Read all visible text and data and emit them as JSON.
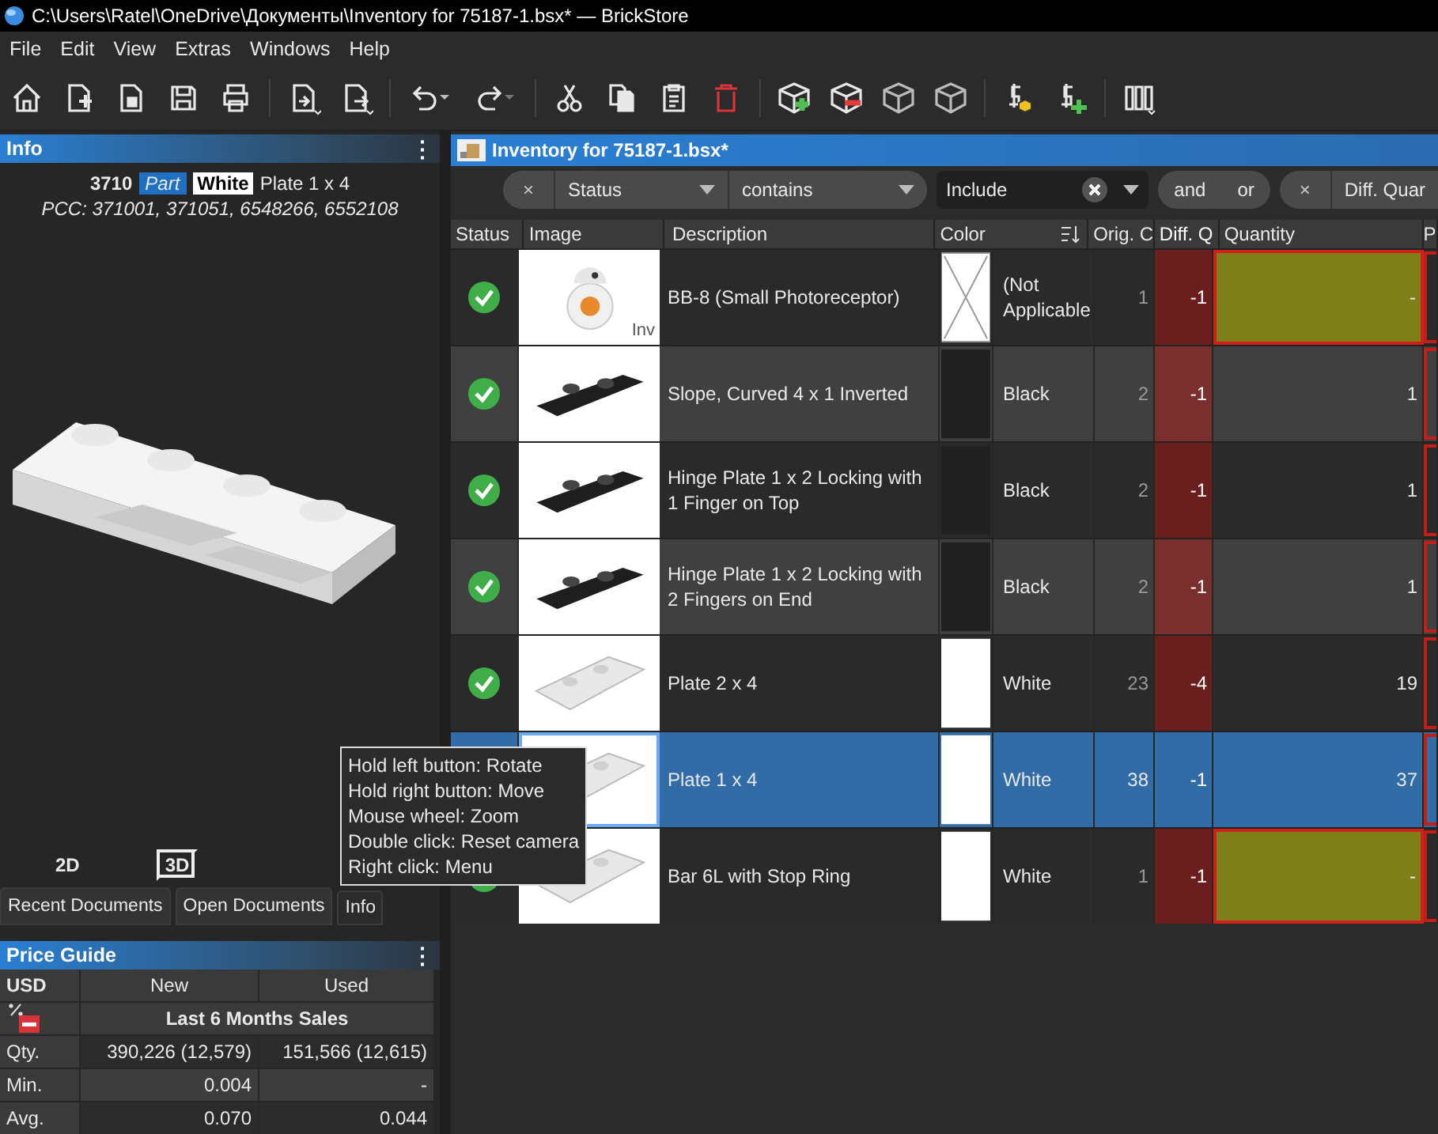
{
  "window": {
    "title": "C:\\Users\\Ratel\\OneDrive\\Документы\\Inventory for 75187-1.bsx* — BrickStore"
  },
  "menu": [
    "File",
    "Edit",
    "View",
    "Extras",
    "Windows",
    "Help"
  ],
  "info_panel": {
    "title": "Info",
    "menu_icon": "⋮",
    "item_id": "3710",
    "item_type": "Part",
    "color_name": "White",
    "item_name": "Plate 1 x 4",
    "pcc": "PCC: 371001, 371051, 6548266, 6552108",
    "view_modes": [
      {
        "label": "2D",
        "selected": false
      },
      {
        "label": "3D",
        "selected": true
      }
    ]
  },
  "tooltip": [
    "Hold left button: Rotate",
    "Hold right button: Move",
    "Mouse wheel: Zoom",
    "Double click: Reset camera",
    "Right click: Menu"
  ],
  "dock_tabs": [
    {
      "label": "Recent Documents",
      "selected": false
    },
    {
      "label": "Open Documents",
      "selected": false
    },
    {
      "label": "Info",
      "selected": true
    }
  ],
  "price_guide": {
    "title": "Price Guide",
    "menu_icon": "⋮",
    "currency": "USD",
    "columns": [
      "New",
      "Used"
    ],
    "period": "Last 6 Months Sales",
    "rows": [
      {
        "label": "Qty.",
        "new": "390,226 (12,579)",
        "used": "151,566 (12,615)"
      },
      {
        "label": "Min.",
        "new": "0.004",
        "used": "-"
      },
      {
        "label": "Avg.",
        "new": "0.070",
        "used": "0.044"
      }
    ]
  },
  "document": {
    "title": "Inventory for 75187-1.bsx*",
    "filters": [
      {
        "remove": "×",
        "field": "Status",
        "operator": "contains",
        "value": "Include"
      }
    ],
    "combinators": [
      "and",
      "or"
    ],
    "next_filter": {
      "remove": "×",
      "field": "Diff. Quar"
    },
    "columns": [
      "Status",
      "Image",
      "Description",
      "Color",
      "Orig. C",
      "Diff. Q",
      "Quantity",
      "P"
    ],
    "rows": [
      {
        "status_ok": true,
        "description": "BB-8 (Small Photoreceptor)",
        "image_badge": "Inv",
        "color": "#ffffff",
        "not_applicable": true,
        "color_name": "(Not Applicable",
        "orig": "1",
        "diff": "-1",
        "quantity": "-",
        "flagged": true,
        "selected": false
      },
      {
        "status_ok": true,
        "description": "Slope, Curved 4 x 1 Inverted",
        "color": "#212121",
        "not_applicable": false,
        "color_name": "Black",
        "orig": "2",
        "diff": "-1",
        "quantity": "1",
        "flagged": false,
        "selected": false
      },
      {
        "status_ok": true,
        "description": "Hinge Plate 1 x 2 Locking with 1 Finger on Top",
        "color": "#212121",
        "not_applicable": false,
        "color_name": "Black",
        "orig": "2",
        "diff": "-1",
        "quantity": "1",
        "flagged": false,
        "selected": false
      },
      {
        "status_ok": true,
        "description": "Hinge Plate 1 x 2 Locking with 2 Fingers on End",
        "color": "#212121",
        "not_applicable": false,
        "color_name": "Black",
        "orig": "2",
        "diff": "-1",
        "quantity": "1",
        "flagged": false,
        "selected": false
      },
      {
        "status_ok": true,
        "description": "Plate 2 x 4",
        "color": "#ffffff",
        "not_applicable": false,
        "color_name": "White",
        "orig": "23",
        "diff": "-4",
        "quantity": "19",
        "flagged": false,
        "selected": false
      },
      {
        "description": "Plate 1 x 4",
        "color": "#ffffff",
        "not_applicable": false,
        "color_name": "White",
        "orig": "38",
        "diff": "-1",
        "quantity": "37",
        "flagged": false,
        "selected": true
      },
      {
        "status_ok": true,
        "description": "Bar 6L with Stop Ring",
        "color": "#ffffff",
        "not_applicable": false,
        "color_name": "White",
        "orig": "1",
        "diff": "-1",
        "quantity": "-",
        "flagged": true,
        "selected": false
      }
    ]
  }
}
